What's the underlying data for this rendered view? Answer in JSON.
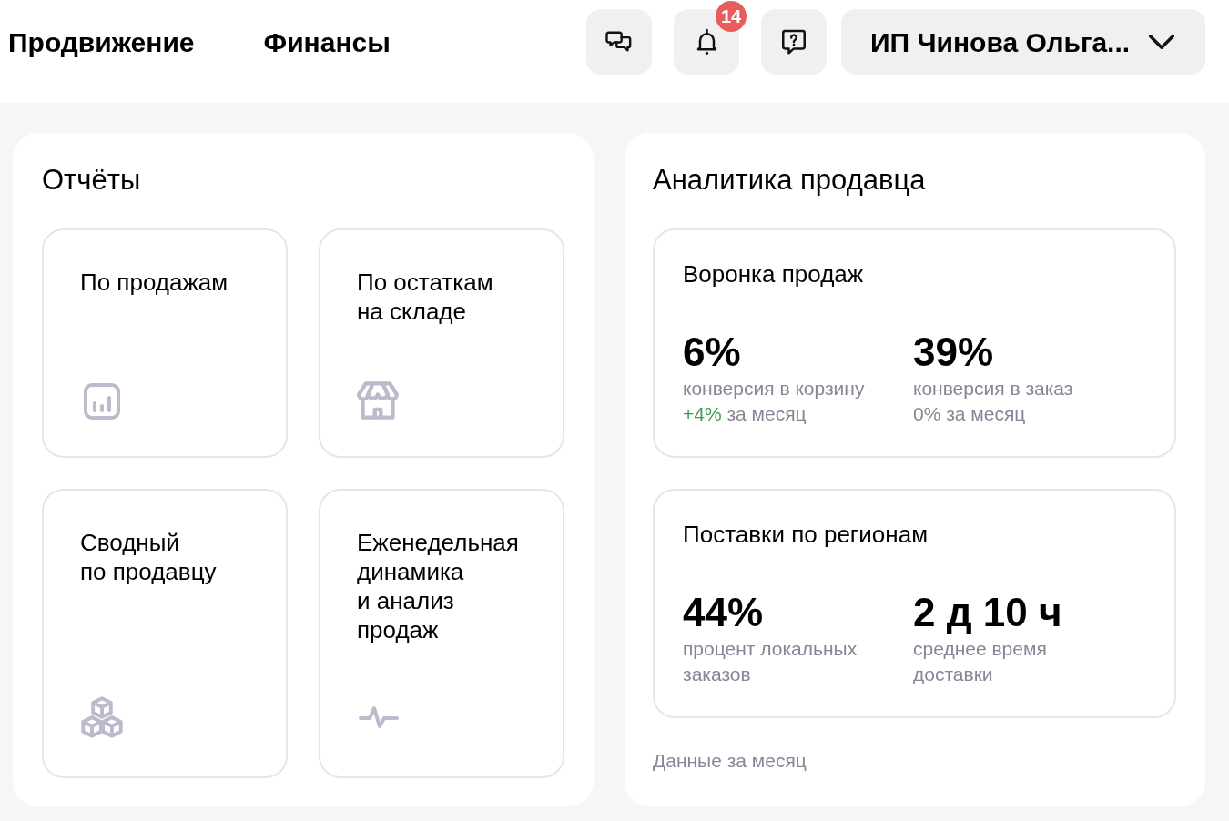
{
  "header": {
    "nav": [
      {
        "label": "Продвижение"
      },
      {
        "label": "Финансы"
      }
    ],
    "notifications": {
      "badge": "14"
    },
    "account": {
      "label": "ИП Чинова Ольга..."
    }
  },
  "reports": {
    "title": "Отчёты",
    "cards": [
      {
        "title": "По продажам"
      },
      {
        "title": "По остаткам\nна складе"
      },
      {
        "title": "Сводный\nпо продавцу"
      },
      {
        "title": "Еженедельная\nдинамика\nи анализ\nпродаж"
      }
    ]
  },
  "analytics": {
    "title": "Аналитика продавца",
    "cards": [
      {
        "title": "Воронка продаж",
        "metrics": [
          {
            "value": "6%",
            "label": "конверсия в корзину",
            "change": "+4%",
            "increased": true,
            "period": "за месяц"
          },
          {
            "value": "39%",
            "label": "конверсия в заказ",
            "change": "0%",
            "increased": false,
            "period": "за месяц"
          }
        ]
      },
      {
        "title": "Поставки по регионам",
        "metrics": [
          {
            "value": "44%",
            "label": "процент локальных\nзаказов"
          },
          {
            "value": "2 д 10 ч",
            "label": "среднее время\nдоставки"
          }
        ]
      }
    ],
    "footnote": "Данные за месяц"
  }
}
